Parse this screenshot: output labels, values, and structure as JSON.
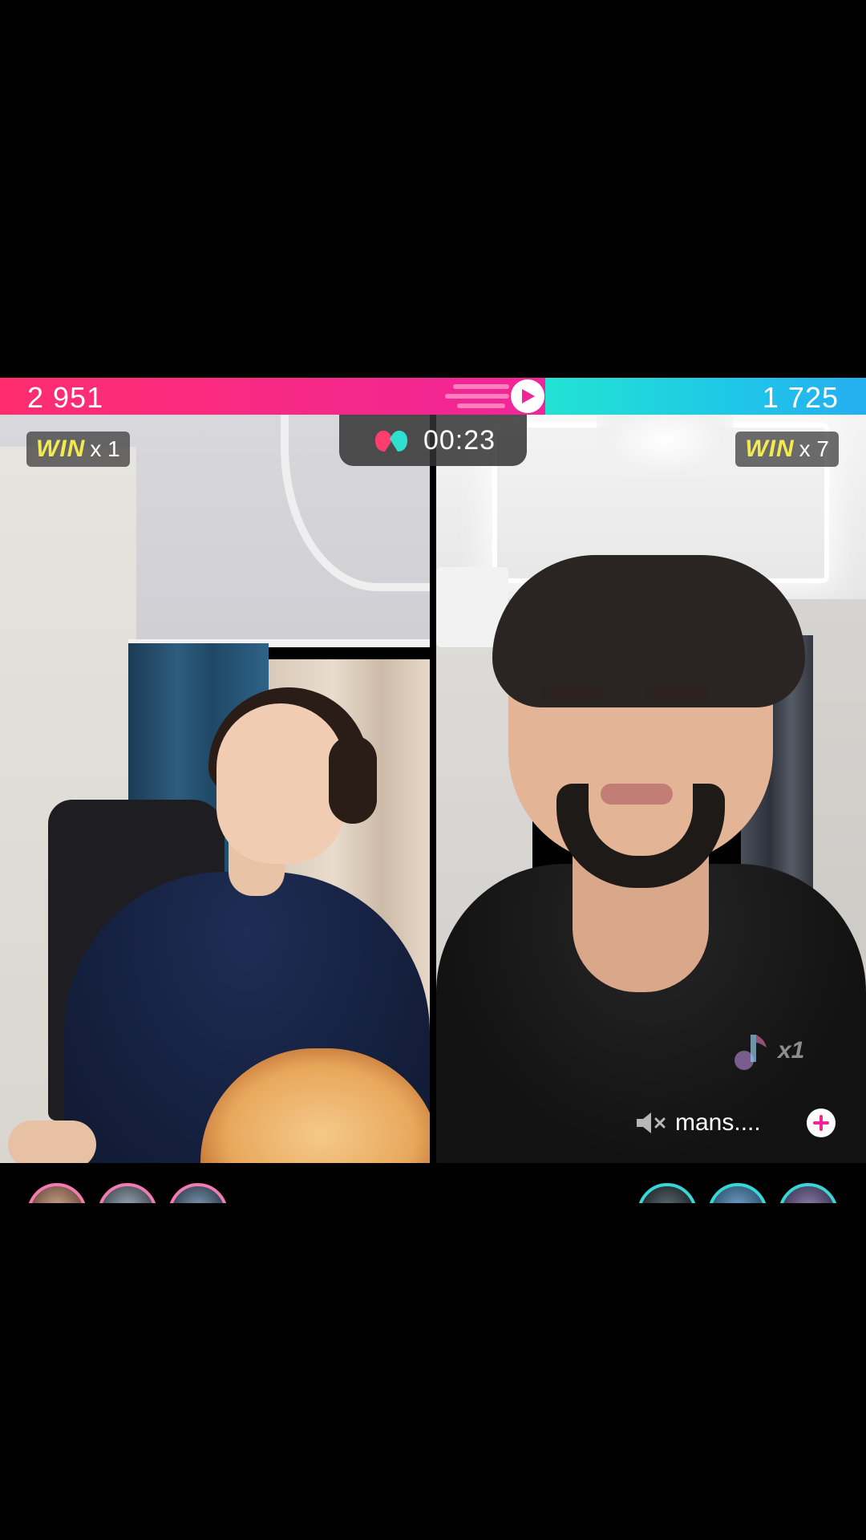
{
  "battle": {
    "left_score": "2 951",
    "right_score": "1 725",
    "timer": "00:23",
    "left_win_label": "WIN",
    "left_win_count": "x 1",
    "right_win_label": "WIN",
    "right_win_count": "x 7",
    "left_score_fraction": 0.63,
    "colors": {
      "left": "#f0259a",
      "right": "#22e3d3",
      "win_text": "#f3ea52"
    }
  },
  "right_panel": {
    "multiplier": "x1",
    "streamer_name": "mans....",
    "mute_icon": "speaker-muted-icon",
    "add_icon": "plus-icon"
  },
  "supporters": {
    "left_count": 3,
    "right_count": 3
  }
}
